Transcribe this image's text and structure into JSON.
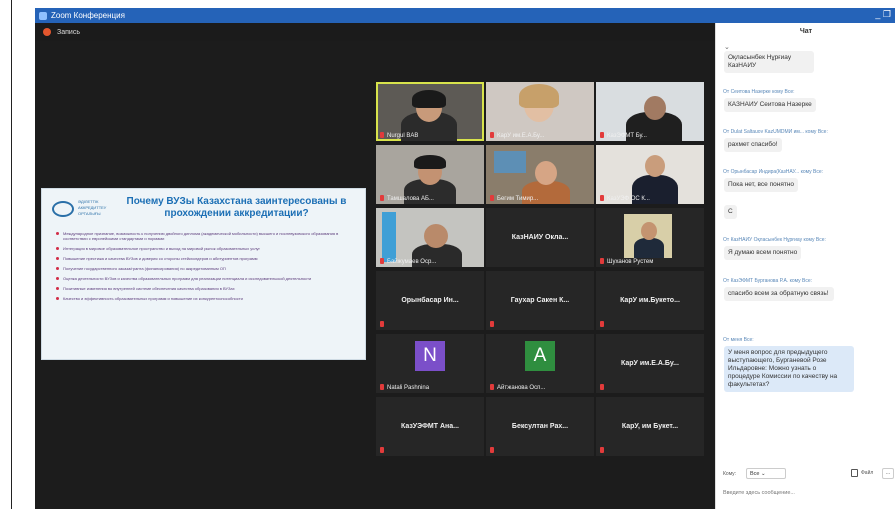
{
  "window": {
    "title": "Zoom Конференция",
    "controls": "_ ❐"
  },
  "recording": {
    "label": "Запись"
  },
  "slide": {
    "logo_text": "ӘДІЛЕТТІК АККРЕДИТТЕУ ОРТАЛЫҒЫ",
    "title": "Почему ВУЗы Казахстана заинтересованы в прохождении аккредитации?",
    "bullets": [
      "Международное признание, возможность к получению двойного диплома (академической мобильности) высшего и послевузовского образования в соответствии с европейскими стандартами и нормами",
      "Интеграция в мировое образовательное пространство и выход на мировой рынок образовательных услуг",
      "Повышение престижа и качества ВУЗов и доверия со стороны стейкхолдеров и абитуриентов программ",
      "Получение государственного заказа/гранта (финансирования) по аккредитованным ОП",
      "Оценка деятельности ВУЗов и качества образовательных программ для реализации потенциала и исследовательской деятельности",
      "Позитивные изменения во внутренней системе обеспечения качества образования в ВУЗах",
      "Качество и эффективность образовательных программ и повышение их конкурентоспособности"
    ]
  },
  "gallery": {
    "tiles": [
      {
        "name": "Nurgul BAB",
        "type": "video",
        "active": true
      },
      {
        "name": "КарУ им.Е.А.Бу...",
        "type": "video"
      },
      {
        "name": "КазЭФМТ Бу...",
        "type": "video"
      },
      {
        "name": "Тамшалова АБ...",
        "type": "video"
      },
      {
        "name": "Бегим Тимир...",
        "type": "video"
      },
      {
        "name": "КазУЭФ ОС К...",
        "type": "video"
      },
      {
        "name": "Байжумаев Оср...",
        "type": "video"
      },
      {
        "name": "КазНАИУ Окла...",
        "type": "text"
      },
      {
        "name": "Шуханов Рустем",
        "type": "video"
      },
      {
        "name": "Орынбасар Ин...",
        "type": "text"
      },
      {
        "name": "Гаухар Сакен К...",
        "type": "text"
      },
      {
        "name": "КарУ им.Букето...",
        "type": "text"
      },
      {
        "name": "Natali Pashnina",
        "type": "avatar",
        "letter": "N",
        "color": "#7b4fc9"
      },
      {
        "name": "Айтжанова Осп...",
        "type": "avatar",
        "letter": "A",
        "color": "#2f8e3f"
      },
      {
        "name": "КарУ им.Е.А.Бу...",
        "type": "text"
      },
      {
        "name": "КазУЭФМТ Ана...",
        "type": "text"
      },
      {
        "name": "Бексултан Рах...",
        "type": "text"
      },
      {
        "name": "КарУ, им Букет...",
        "type": "text"
      }
    ]
  },
  "chat": {
    "header": "Чат",
    "messages": [
      {
        "meta": "",
        "text": "Оқласынбек Нұрғиау КазНАИУ"
      },
      {
        "meta": "От Сеитова Назерке кому Все:",
        "text": "КАЗНАИУ Сеитова Назерке"
      },
      {
        "meta": "От Dulat Saltauov KazUMDMИ им... кому Все:",
        "text": "рахмет спасибо!"
      },
      {
        "meta": "От Орынбасар Индира(КазНАУ... кому Все:",
        "text": "Пока нет, все понятно"
      },
      {
        "meta": "",
        "text": "С"
      },
      {
        "meta": "От КазНАИУ Оқласынбек Нұрғиау кому Все:",
        "text": "Я думаю всем понятно"
      },
      {
        "meta": "От КазЭФМТ Бурганова Р.А. кому Все:",
        "text": "спасибо всем за обратную связь!"
      },
      {
        "meta": "От меня Все:",
        "text": "У меня вопрос для предыдущего выступающего, Бурганевой Розе Ильдаровне: Можно узнать о процедуре Комиссии по качеству на факультетах?",
        "mine": true
      }
    ],
    "to_label": "Кому:",
    "to_value": "Все",
    "file_label": "Файл",
    "more_label": "...",
    "input_placeholder": "Введите здесь сообщение..."
  }
}
